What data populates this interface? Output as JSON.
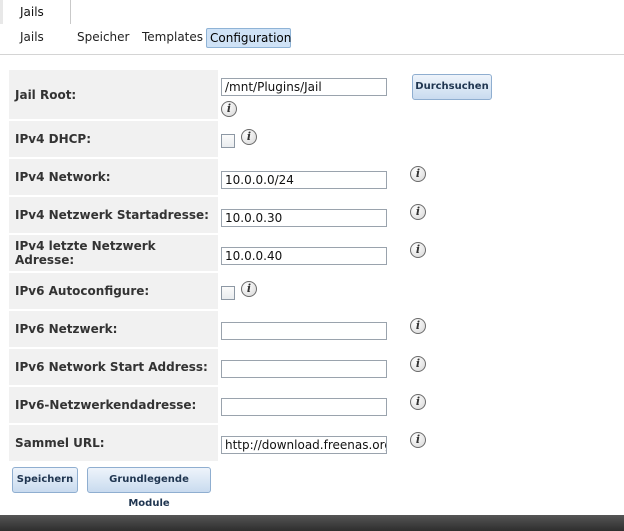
{
  "top_tab": {
    "label": "Jails"
  },
  "sub_tabs": [
    {
      "label": "Jails"
    },
    {
      "label": "Speicher"
    },
    {
      "label": "Templates"
    },
    {
      "label": "Configuration"
    }
  ],
  "form": {
    "jail_root": {
      "label": "Jail Root:",
      "value": "/mnt/Plugins/Jail",
      "browse_label": "Durchsuchen"
    },
    "ipv4_dhcp": {
      "label": "IPv4 DHCP:",
      "checked": false
    },
    "ipv4_network": {
      "label": "IPv4 Network:",
      "value": "10.0.0.0/24"
    },
    "ipv4_start": {
      "label": "IPv4 Netzwerk Startadresse:",
      "value": "10.0.0.30"
    },
    "ipv4_end": {
      "label": "IPv4 letzte Netzwerk Adresse:",
      "value": "10.0.0.40"
    },
    "ipv6_autoconfigure": {
      "label": "IPv6 Autoconfigure:",
      "checked": false
    },
    "ipv6_network": {
      "label": "IPv6 Netzwerk:",
      "value": ""
    },
    "ipv6_start": {
      "label": "IPv6 Network Start Address:",
      "value": ""
    },
    "ipv6_end": {
      "label": "IPv6-Netzwerkendadresse:",
      "value": ""
    },
    "collection_url": {
      "label": "Sammel URL:",
      "value": "http://download.freenas.org"
    }
  },
  "buttons": {
    "save": "Speichern",
    "basic_modules": "Grundlegende Module"
  },
  "info_glyph": "i"
}
